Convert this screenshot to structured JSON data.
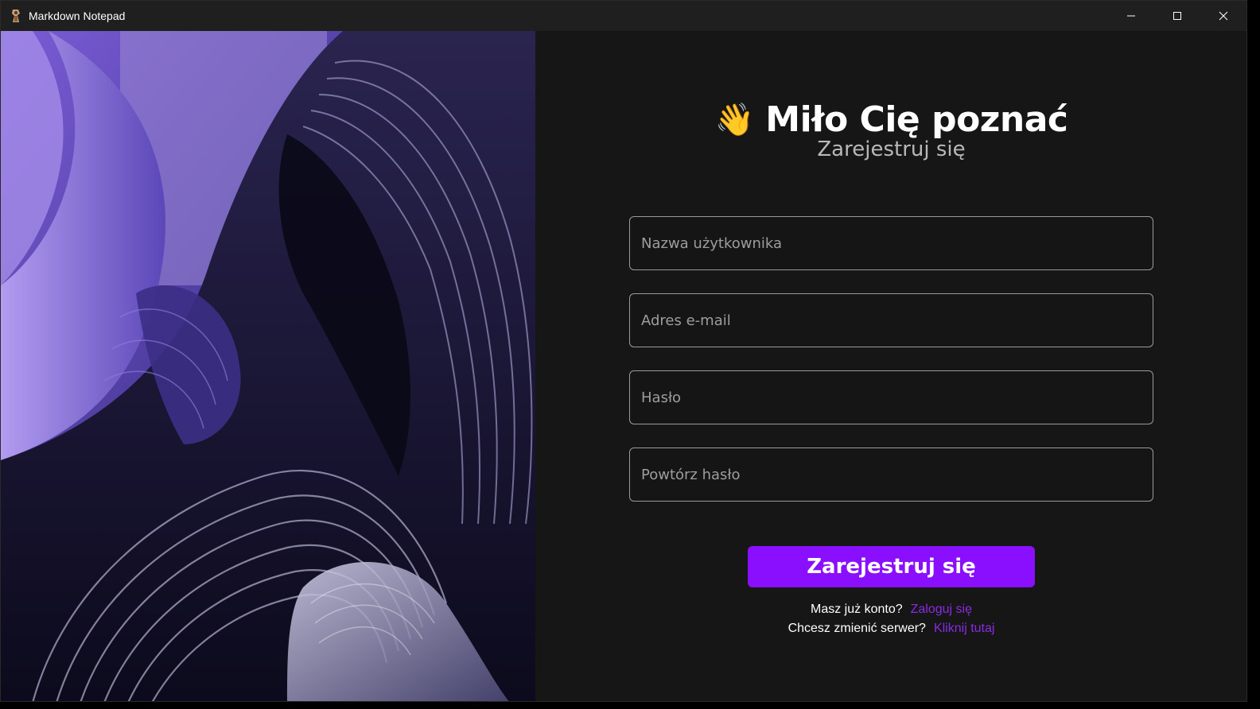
{
  "window": {
    "title": "Markdown Notepad"
  },
  "colors": {
    "accent": "#8a0fff",
    "link": "#8a2be2",
    "background": "#161616"
  },
  "header": {
    "emoji": "👋",
    "title": "Miło Cię poznać",
    "subtitle": "Zarejestruj się"
  },
  "form": {
    "username_placeholder": "Nazwa użytkownika",
    "email_placeholder": "Adres e-mail",
    "password_placeholder": "Hasło",
    "repeat_password_placeholder": "Powtórz hasło",
    "submit_label": "Zarejestruj się"
  },
  "footer": {
    "login_question": "Masz już konto?",
    "login_link": "Zaloguj się",
    "server_question": "Chcesz zmienić serwer?",
    "server_link": "Kliknij tutaj"
  }
}
